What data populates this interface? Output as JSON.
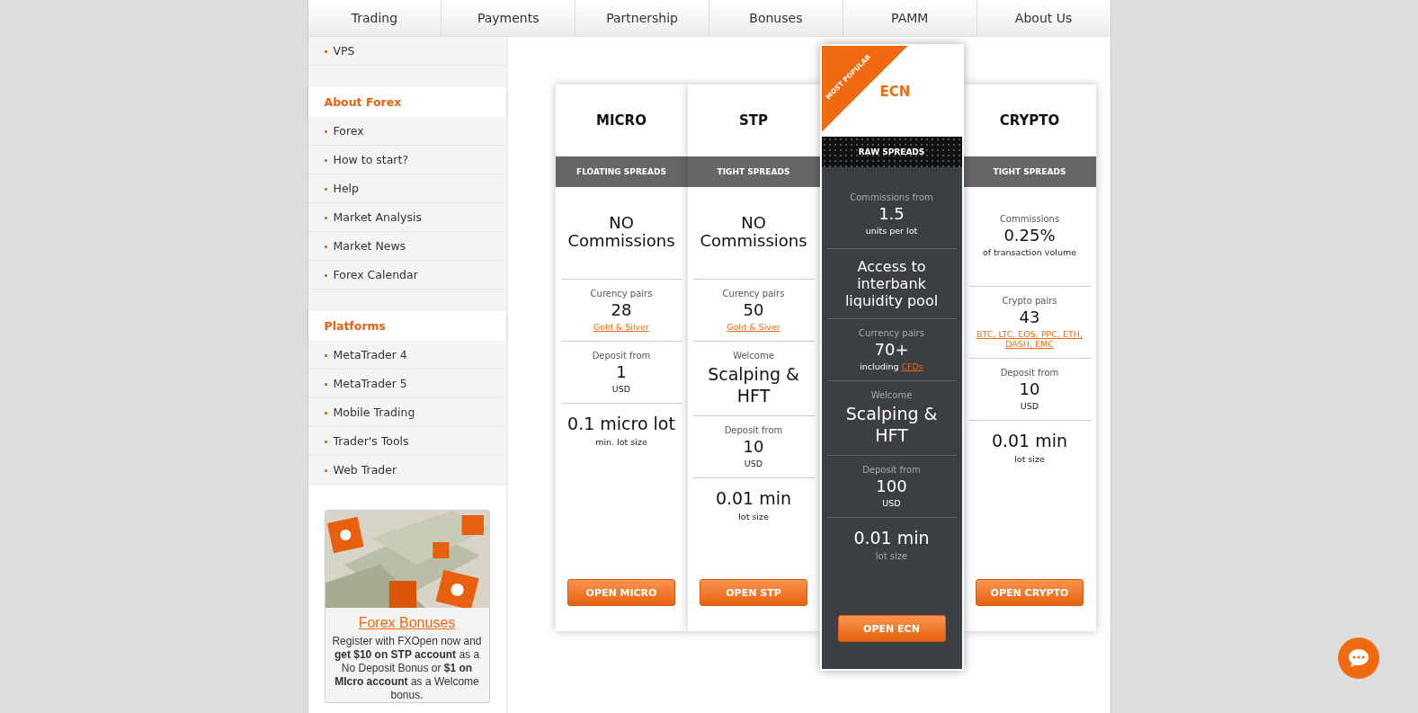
{
  "nav": [
    {
      "label": "Trading"
    },
    {
      "label": "Payments"
    },
    {
      "label": "Partnership"
    },
    {
      "label": "Bonuses"
    },
    {
      "label": "PAMM"
    },
    {
      "label": "About Us"
    }
  ],
  "sidebar": {
    "top_items": [
      "VPS"
    ],
    "groups": [
      {
        "heading": "About Forex",
        "items": [
          "Forex",
          "How to start?",
          "Help",
          "Market Analysis",
          "Market News",
          "Forex Calendar"
        ]
      },
      {
        "heading": "Platforms",
        "items": [
          "MetaTrader 4",
          "MetaTrader 5",
          "Mobile Trading",
          "Trader's Tools",
          "Web Trader"
        ]
      }
    ],
    "promo": {
      "title": "Forex Bonuses",
      "text": "Register with FXOpen now and **get $10 on STP account** as a No Deposit Bonus or **$1 on MIcro account** as a Welcome bonus."
    }
  },
  "plans": [
    {
      "name": "MICRO",
      "featured": false,
      "spreads": "FLOATING SPREADS",
      "button": "OPEN MICRO",
      "sections": [
        {
          "lines": [
            {
              "kind": "value",
              "text": "NO Commissions"
            }
          ]
        },
        {
          "lines": [
            {
              "kind": "label",
              "text": "Curency pairs"
            },
            {
              "kind": "value",
              "text": "28"
            },
            {
              "kind": "link",
              "text": "Gold & Silver"
            }
          ]
        },
        {
          "lines": [
            {
              "kind": "label",
              "text": "Deposit from"
            },
            {
              "kind": "value",
              "text": "1"
            },
            {
              "kind": "note",
              "text": "USD"
            }
          ]
        },
        {
          "lines": [
            {
              "kind": "big",
              "text": "0.1 micro lot"
            },
            {
              "kind": "note",
              "text": "min. lot size"
            }
          ]
        }
      ]
    },
    {
      "name": "STP",
      "featured": false,
      "spreads": "TIGHT SPREADS",
      "button": "OPEN STP",
      "sections": [
        {
          "lines": [
            {
              "kind": "value",
              "text": "NO Commissions"
            }
          ]
        },
        {
          "lines": [
            {
              "kind": "label",
              "text": "Curency pairs"
            },
            {
              "kind": "value",
              "text": "50"
            },
            {
              "kind": "link",
              "text": "Gold & Siver"
            }
          ]
        },
        {
          "lines": [
            {
              "kind": "label",
              "text": "Welcome"
            },
            {
              "kind": "big",
              "text": "Scalping & HFT"
            }
          ]
        },
        {
          "lines": [
            {
              "kind": "label",
              "text": "Deposit from"
            },
            {
              "kind": "value",
              "text": "10"
            },
            {
              "kind": "note",
              "text": "USD"
            }
          ]
        },
        {
          "lines": [
            {
              "kind": "big",
              "text": "0.01 min"
            },
            {
              "kind": "note",
              "text": "lot size"
            }
          ]
        }
      ]
    },
    {
      "name": "ECN",
      "featured": true,
      "badge": "MOST POPULAR",
      "spreads": "RAW SPREADS",
      "button": "OPEN ECN",
      "sections": [
        {
          "lines": [
            {
              "kind": "label",
              "text": "Commissions from"
            },
            {
              "kind": "value",
              "text": "1.5"
            },
            {
              "kind": "note",
              "text": "units per lot"
            }
          ]
        },
        {
          "lines": [
            {
              "kind": "value",
              "text": "Access to interbank liquidity pool"
            }
          ]
        },
        {
          "lines": [
            {
              "kind": "label",
              "text": "Currency pairs"
            },
            {
              "kind": "value",
              "text": "70+"
            },
            {
              "kind": "note_link",
              "text": "including",
              "link": "CFDs"
            }
          ]
        },
        {
          "lines": [
            {
              "kind": "label",
              "text": "Welcome"
            },
            {
              "kind": "big",
              "text": "Scalping & HFT"
            }
          ]
        },
        {
          "lines": [
            {
              "kind": "label",
              "text": "Deposit from"
            },
            {
              "kind": "value",
              "text": "100"
            },
            {
              "kind": "note",
              "text": "USD"
            }
          ]
        },
        {
          "lines": [
            {
              "kind": "big",
              "text": "0.01 min"
            },
            {
              "kind": "label",
              "text": "lot size"
            }
          ]
        }
      ]
    },
    {
      "name": "CRYPTO",
      "featured": false,
      "spreads": "TIGHT SPREADS",
      "button": "OPEN CRYPTO",
      "sections": [
        {
          "lines": [
            {
              "kind": "label",
              "text": "Commissions"
            },
            {
              "kind": "value",
              "text": "0.25%"
            },
            {
              "kind": "note",
              "text": "of transaction volume"
            }
          ]
        },
        {
          "lines": [
            {
              "kind": "label",
              "text": "Crypto pairs"
            },
            {
              "kind": "value",
              "text": "43"
            },
            {
              "kind": "link",
              "text": "BTC, LTC, EOS, PPC, ETH, DASH, EMC"
            }
          ]
        },
        {
          "lines": [
            {
              "kind": "label",
              "text": "Deposit from"
            },
            {
              "kind": "value",
              "text": "10"
            },
            {
              "kind": "note",
              "text": "USD"
            }
          ]
        },
        {
          "lines": [
            {
              "kind": "big",
              "text": "0.01 min"
            },
            {
              "kind": "note",
              "text": "lot size"
            }
          ]
        }
      ]
    }
  ]
}
